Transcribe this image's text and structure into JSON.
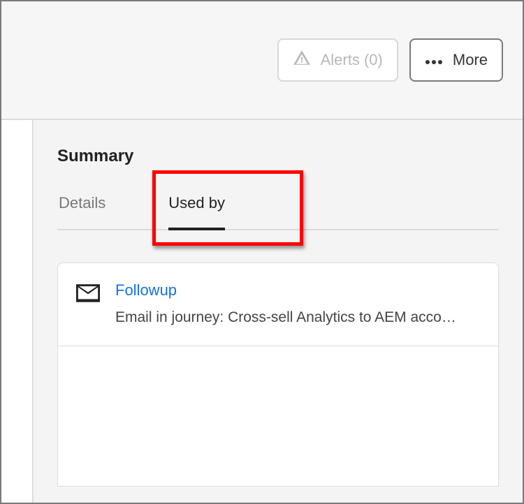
{
  "toolbar": {
    "alerts_label": "Alerts (0)",
    "more_label": "More"
  },
  "panel": {
    "title": "Summary",
    "tabs": [
      {
        "label": "Details",
        "active": false
      },
      {
        "label": "Used by",
        "active": true
      }
    ],
    "usedBy": [
      {
        "title": "Followup",
        "subtitle": "Email in journey: Cross-sell Analytics to AEM acco…",
        "icon": "envelope"
      }
    ]
  }
}
